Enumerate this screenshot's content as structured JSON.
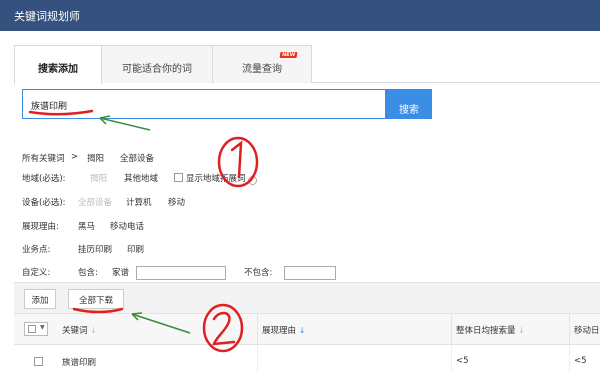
{
  "app": {
    "title": "关键词规划师"
  },
  "tabs": [
    {
      "label": "搜索添加"
    },
    {
      "label": "可能适合你的词"
    },
    {
      "label": "流量查询",
      "badge": "NEW"
    }
  ],
  "search": {
    "value": "族谱印刷",
    "button_label": "搜索"
  },
  "breadcrumb": {
    "root": "所有关键词",
    "sep": ">",
    "item1": "揭阳",
    "item2": "全部设备"
  },
  "filters": {
    "region": {
      "label": "地域(必选):",
      "opt1": "揭阳",
      "opt2": "其他地域",
      "checkbox_label": "显示地域拓展词",
      "help": "?"
    },
    "device": {
      "label": "设备(必选):",
      "opt1": "全部设备",
      "opt2": "计算机",
      "opt3": "移动"
    },
    "reason": {
      "label": "展现理由:",
      "opt1": "黑马",
      "opt2": "移动电话"
    },
    "business": {
      "label": "业务点:",
      "opt1": "挂历印刷",
      "opt2": "印刷"
    },
    "custom": {
      "label": "自定义:",
      "include_label": "包含:",
      "include_value": "家谱",
      "exclude_label": "不包含:"
    }
  },
  "toolbar": {
    "add_label": "添加",
    "download_label": "全部下载"
  },
  "table": {
    "headers": [
      "关键词",
      "展现理由",
      "整体日均搜索量",
      "移动日"
    ],
    "sort_arrow": "↓",
    "rows": [
      {
        "keyword": "族谱印刷",
        "reason": "",
        "volume": "<5",
        "mobile": "<5"
      }
    ]
  },
  "annotations": {
    "mark1": "①",
    "mark2": "②"
  },
  "colors": {
    "titlebar": "#35517e",
    "accent": "#3a8ee6",
    "annotation_red": "#e02020",
    "annotation_green": "#3a8a3a",
    "badge": "#e8321c"
  }
}
